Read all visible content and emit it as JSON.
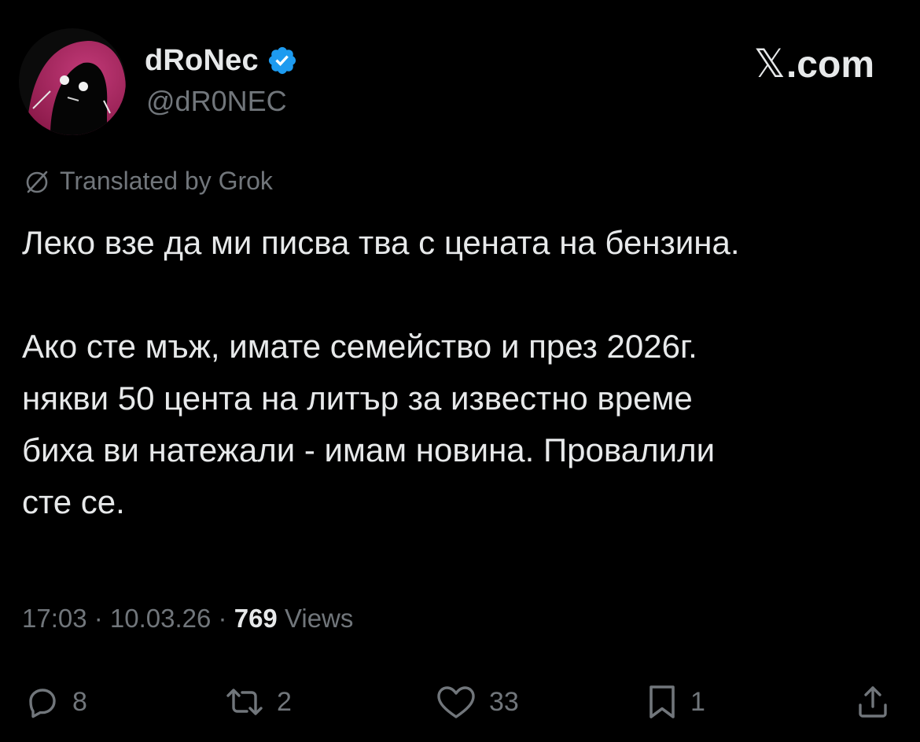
{
  "author": {
    "display_name": "dRoNec",
    "handle": "@dR0NEC",
    "verified_icon": "verified-badge-icon",
    "verified_color": "#1d9bf0"
  },
  "brand": {
    "logo_letter": "𝕏",
    "suffix": ".com"
  },
  "translation": {
    "icon": "translate-icon",
    "label": "Translated by Grok"
  },
  "tweet": {
    "line1": "Леко взе да ми писва тва с цената на бензина.",
    "para2_line1": "Ако сте мъж, имате семейство и през 2026г.",
    "para2_line2": "някви 50 цента на литър за известно време",
    "para2_line3": "биха ви натежали - имам новина. Провалили",
    "para2_line4": "сте се."
  },
  "meta": {
    "time": "17:03",
    "separator": " · ",
    "date": "10.03.26",
    "views_count": "769",
    "views_label": " Views"
  },
  "actions": {
    "replies": "8",
    "reposts": "2",
    "likes": "33",
    "bookmarks": "1"
  },
  "colors": {
    "background": "#000000",
    "text_primary": "#e7e9ea",
    "text_secondary": "#71767b",
    "avatar_accent": "#b0245f"
  }
}
